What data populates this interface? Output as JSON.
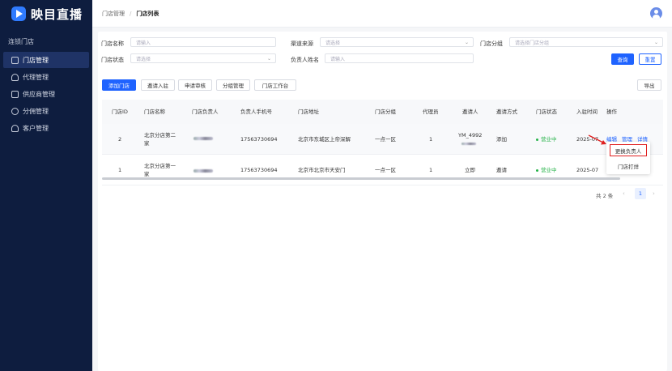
{
  "brand": {
    "name": "映目直播"
  },
  "sidebar": {
    "group": "连锁门店",
    "items": [
      {
        "label": "门店管理",
        "icon": "store-icon",
        "active": true
      },
      {
        "label": "代理管理",
        "icon": "agent-icon",
        "active": false
      },
      {
        "label": "供应商管理",
        "icon": "supplier-icon",
        "active": false
      },
      {
        "label": "分佣管理",
        "icon": "commission-icon",
        "active": false
      },
      {
        "label": "客户管理",
        "icon": "customer-icon",
        "active": false
      }
    ]
  },
  "header": {
    "crumb_parent": "门店管理",
    "crumb_separator": "/",
    "crumb_current": "门店列表"
  },
  "filters": {
    "store_name": {
      "label": "门店名称",
      "placeholder": "请输入"
    },
    "channel": {
      "label": "渠道来源",
      "placeholder": "请选择"
    },
    "store_group": {
      "label": "门店分组",
      "placeholder": "请选择门店分组"
    },
    "store_status": {
      "label": "门店状态",
      "placeholder": "请选择"
    },
    "manager_name": {
      "label": "负责人姓名",
      "placeholder": "请输入"
    },
    "search_label": "查询",
    "reset_label": "重置"
  },
  "toolbar": {
    "add_store": "添加门店",
    "invite": "邀请入驻",
    "review": "申请审核",
    "group_manage": "分组管理",
    "workbench": "门店工作台",
    "export": "导出"
  },
  "table": {
    "columns": [
      "门店ID",
      "门店名称",
      "门店负责人",
      "负责人手机号",
      "门店地址",
      "门店分组",
      "代理员",
      "邀请人",
      "邀请方式",
      "门店状态",
      "入驻时间",
      "操作"
    ],
    "rows": [
      {
        "id": "2",
        "name_l1": "北京分店第二",
        "name_l2": "家",
        "phone": "17563730694",
        "address": "北京市东城区上帝深解",
        "group": "一点一区",
        "agent": "1",
        "inviter": "YM_4992",
        "invite_method": "添加",
        "status": "营业中",
        "join_time": "2025-07",
        "actions": [
          "编辑",
          "管理",
          "详情"
        ]
      },
      {
        "id": "1",
        "name_l1": "北京分店第一",
        "name_l2": "家",
        "phone": "17563730694",
        "address": "北京市北京市天安门",
        "group": "一点一区",
        "agent": "1",
        "inviter": "立即",
        "invite_method": "邀请",
        "status": "营业中",
        "join_time": "2025-07",
        "actions": []
      }
    ]
  },
  "dropdown": {
    "items": [
      "更换负责人",
      "门店打烊"
    ]
  },
  "pagination": {
    "total": "共 2 条",
    "prev": "‹",
    "page": "1",
    "next": "›"
  },
  "colors": {
    "primary": "#1f63ff",
    "sidebar": "#0e1d3f",
    "status_green": "#27b34a",
    "highlight_red": "#e02020"
  }
}
